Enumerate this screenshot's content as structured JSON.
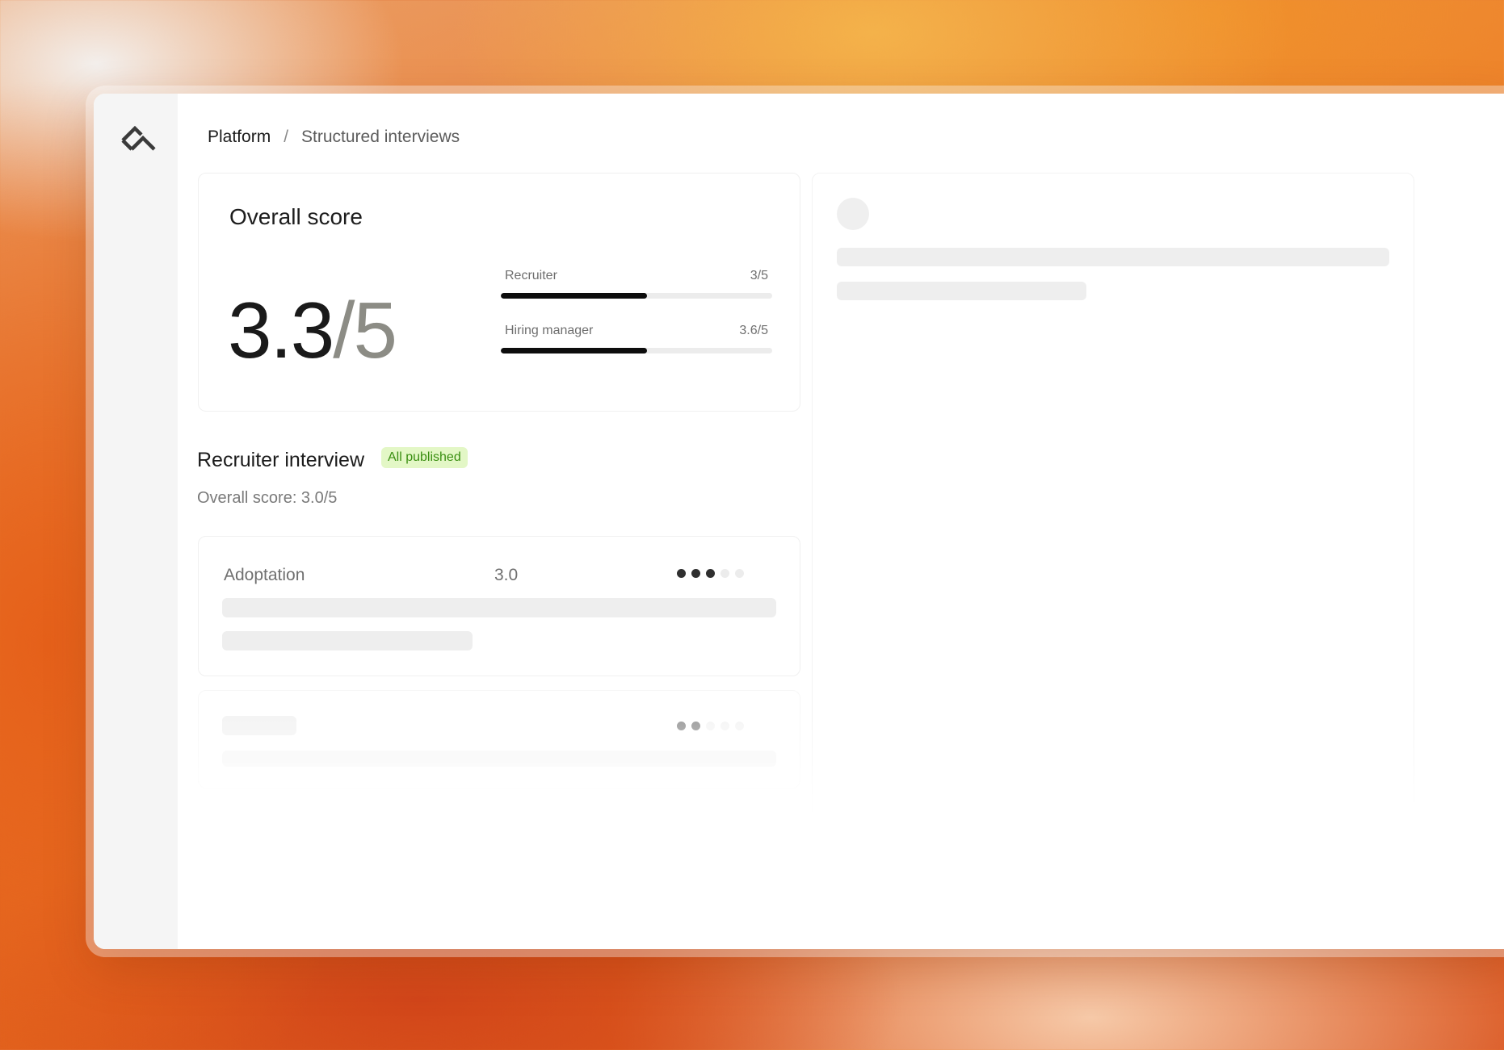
{
  "breadcrumb": {
    "root": "Platform",
    "separator": "/",
    "current": "Structured interviews"
  },
  "overall": {
    "title": "Overall score",
    "score": "3.3",
    "denominator": "/5",
    "breakdown": [
      {
        "label": "Recruiter",
        "value": "3/5",
        "fill": 0.54
      },
      {
        "label": "Hiring manager",
        "value": "3.6/5",
        "fill": 0.54
      }
    ]
  },
  "recruiter_interview": {
    "title": "Recruiter interview",
    "badge": "All published",
    "overall_score": "Overall score: 3.0/5",
    "criteria": [
      {
        "name": "Adoptation",
        "score": "3.0",
        "rating": 3,
        "max": 5
      },
      {
        "name": "",
        "score": "",
        "rating": 2,
        "max": 5
      }
    ]
  },
  "colors": {
    "accent": "#0d0d0d",
    "badge_bg": "#e3f7c6",
    "badge_text": "#3a8f12",
    "skeleton": "#eeeeee"
  },
  "icons": {
    "logo": "diamond-logo-icon"
  }
}
